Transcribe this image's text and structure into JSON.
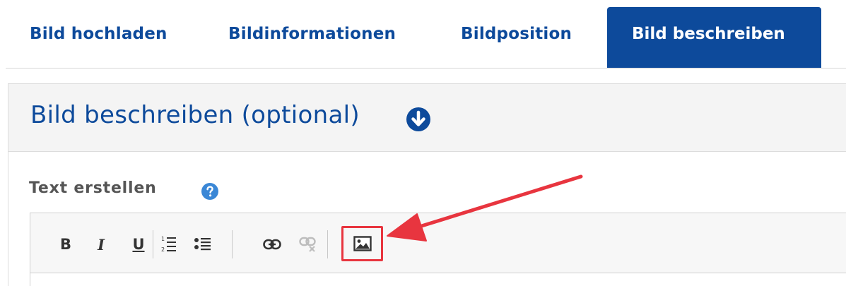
{
  "tabs": [
    {
      "label": "Bild hochladen",
      "active": false
    },
    {
      "label": "Bildinformationen",
      "active": false
    },
    {
      "label": "Bildposition",
      "active": false
    },
    {
      "label": "Bild beschreiben",
      "active": true
    }
  ],
  "panel": {
    "title": "Bild beschreiben (optional)",
    "toggle_icon": "chevron-down-circle-icon"
  },
  "field": {
    "label": "Text erstellen",
    "help_icon": "question-circle-icon"
  },
  "toolbar": {
    "bold": "B",
    "italic": "I",
    "underline": "U",
    "buttons": [
      "bold",
      "italic",
      "underline",
      "ordered-list",
      "bullet-list",
      "link",
      "unlink",
      "insert-image"
    ]
  },
  "colors": {
    "brand_blue": "#0d4a9b",
    "help_blue": "#3a87d6",
    "highlight_red": "#e8353f"
  }
}
